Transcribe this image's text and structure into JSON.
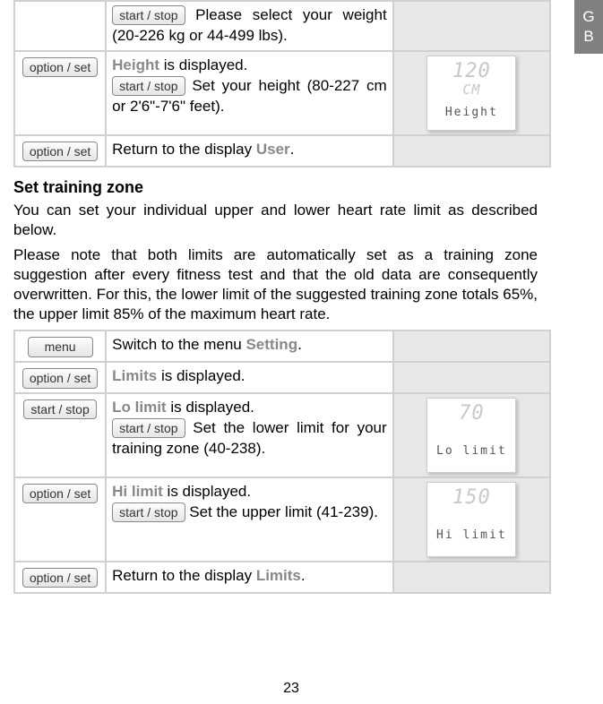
{
  "sideTab": "G\nB",
  "buttons": {
    "startStop": "start / stop",
    "optionSet": "option / set",
    "menu": "menu"
  },
  "table1": {
    "row1_text": " Please select your weight (20-226 kg or 44-499 lbs).",
    "row2_label": "Height",
    "row2_text_a": " is displayed.",
    "row2_text_b": " Set your height (80-227 cm or 2'6\"-7'6\" feet).",
    "row2_display": {
      "big": "120",
      "sm": "CM",
      "lbl": "Height"
    },
    "row3_text_a": "Return to the display ",
    "row3_label": "User",
    "row3_text_b": "."
  },
  "section": {
    "title": "Set training zone",
    "p1": "You can set your individual upper and lower heart rate limit as described below.",
    "p2": "Please note that both limits are automatically set as a training zone suggestion after every fitness test and that the old data are consequently overwritten. For this, the lower limit of the suggested training zone totals 65%, the upper limit 85% of the maximum heart rate."
  },
  "table2": {
    "row1_text_a": "Switch to the menu ",
    "row1_label": "Setting",
    "row1_text_b": ".",
    "row2_label": "Limits",
    "row2_text": " is displayed.",
    "row3_label": "Lo limit",
    "row3_text_a": " is displayed.",
    "row3_text_b": " Set the lower limit for your training zone (40-238).",
    "row3_display": {
      "big": "70",
      "lbl": "Lo limit"
    },
    "row4_label": "Hi limit",
    "row4_text_a": " is displayed.",
    "row4_text_b": " Set the upper limit (41-239).",
    "row4_display": {
      "big": "150",
      "lbl": "Hi limit"
    },
    "row5_text_a": "Return to the display ",
    "row5_label": "Limits",
    "row5_text_b": "."
  },
  "pageNumber": "23"
}
